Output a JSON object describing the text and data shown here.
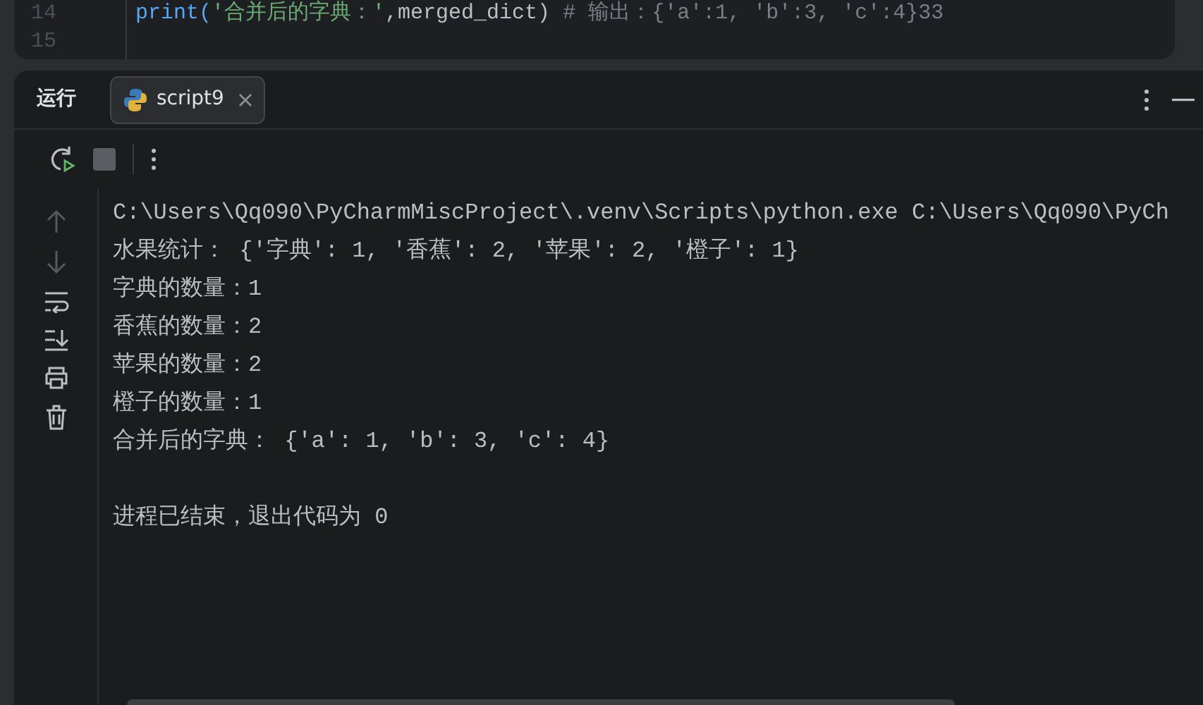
{
  "editor": {
    "lines": [
      {
        "number": "14",
        "tokens": [
          {
            "kind": "function",
            "text": "print("
          },
          {
            "kind": "string",
            "text": "'合并后的字典：'"
          },
          {
            "kind": "plain",
            "text": ",merged_dict)"
          },
          {
            "kind": "comment",
            "text": "  # 输出：{'a':1, 'b':3, 'c':4}33"
          }
        ]
      },
      {
        "number": "15"
      }
    ]
  },
  "run_panel": {
    "title": "运行",
    "tabs": [
      {
        "label": "script9",
        "selected": true
      }
    ],
    "console": [
      {
        "kind": "text",
        "text": "C:\\Users\\Qq090\\PyCharmMiscProject\\.venv\\Scripts\\python.exe C:\\Users\\Qq090\\PyCh"
      },
      {
        "kind": "text",
        "text": "水果统计： {'字典': 1, '香蕉': 2, '苹果': 2, '橙子': 1}"
      },
      {
        "kind": "text",
        "text": "字典的数量：1"
      },
      {
        "kind": "text",
        "text": "香蕉的数量：2"
      },
      {
        "kind": "text",
        "text": "苹果的数量：2"
      },
      {
        "kind": "text",
        "text": "橙子的数量：1"
      },
      {
        "kind": "text",
        "text": "合并后的字典： {'a': 1, 'b': 3, 'c': 4}"
      },
      {
        "kind": "blank"
      },
      {
        "kind": "text",
        "text": "进程已结束，退出代码为 0"
      }
    ]
  }
}
